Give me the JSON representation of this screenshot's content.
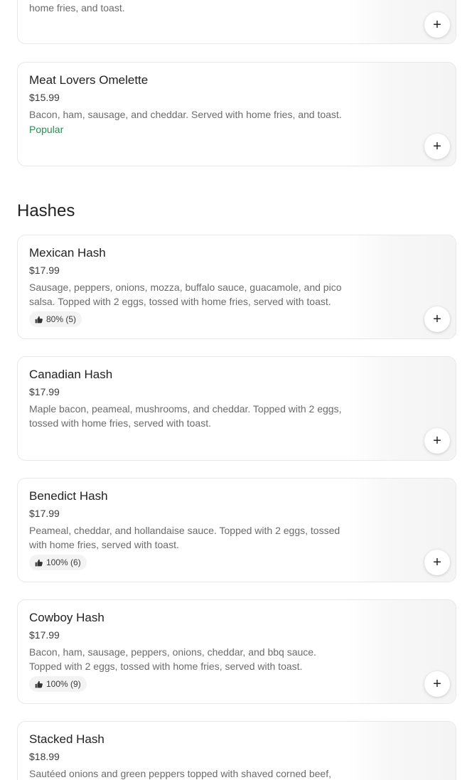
{
  "items_above": [
    {
      "desc_tail": "home fries, and toast.",
      "add_label": "+"
    },
    {
      "name": "Meat Lovers Omelette",
      "price": "$15.99",
      "desc": "Bacon, ham, sausage, and cheddar. Served with home fries, and toast.",
      "badge": "Popular",
      "add_label": "+"
    }
  ],
  "section": {
    "title": "Hashes"
  },
  "hashes": [
    {
      "name": "Mexican Hash",
      "price": "$17.99",
      "desc": "Sausage, peppers, onions, mozza, buffalo sauce, guacamole, and pico salsa. Topped with 2 eggs, tossed with home fries, served with toast.",
      "rating": "80% (5)",
      "add_label": "+"
    },
    {
      "name": "Canadian Hash",
      "price": "$17.99",
      "desc": "Maple bacon, peameal, mushrooms, and cheddar. Topped with 2 eggs, tossed with home fries, served with toast.",
      "add_label": "+"
    },
    {
      "name": "Benedict Hash",
      "price": "$17.99",
      "desc": "Peameal, cheddar, and hollandaise sauce. Topped with 2 eggs, tossed with home fries, served with toast.",
      "rating": "100% (6)",
      "add_label": "+"
    },
    {
      "name": "Cowboy Hash",
      "price": "$17.99",
      "desc": "Bacon, ham, sausage, peppers, onions, cheddar, and bbq sauce. Topped with 2 eggs, tossed with home fries, served with toast.",
      "rating": "100% (9)",
      "add_label": "+"
    },
    {
      "name": "Stacked Hash",
      "price": "$18.99",
      "desc": "Sautéed onions and green peppers topped with shaved corned beef,",
      "add_label": "+"
    }
  ],
  "icons": {
    "add": "plus-icon",
    "rating": "thumbs-up-icon"
  },
  "colors": {
    "popular": "#2e8b57",
    "badge_bg": "#f3f3f3",
    "border": "#e8e8e8"
  }
}
